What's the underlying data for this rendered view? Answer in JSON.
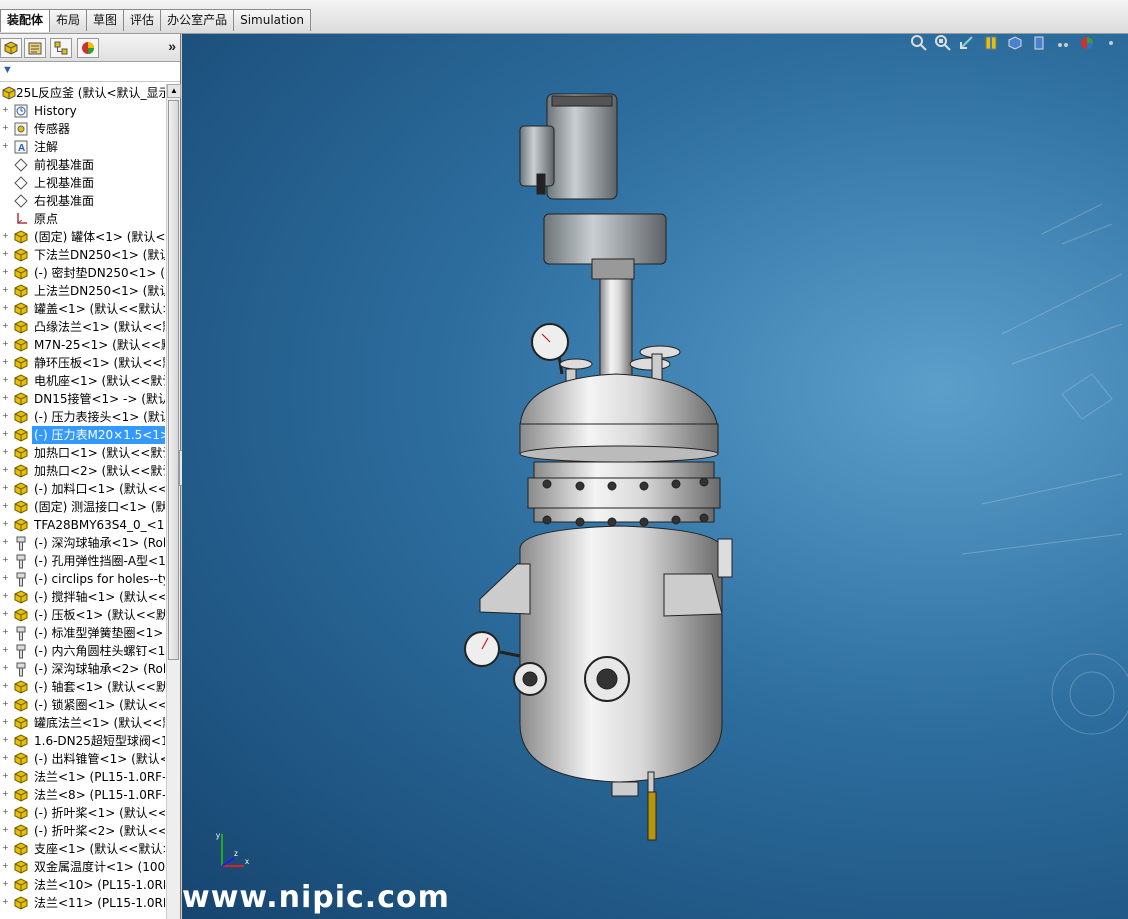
{
  "tabs": [
    {
      "label": "装配体",
      "active": true
    },
    {
      "label": "布局",
      "active": false
    },
    {
      "label": "草图",
      "active": false
    },
    {
      "label": "评估",
      "active": false
    },
    {
      "label": "办公室产品",
      "active": false
    },
    {
      "label": "Simulation",
      "active": false
    }
  ],
  "panel": {
    "expand_label": "»",
    "filter_label": "▼"
  },
  "tree": {
    "root": "25L反应釜 (默认<默认_显示",
    "items": [
      {
        "label": "History",
        "icon": "history-icon"
      },
      {
        "label": "传感器",
        "icon": "sensor-icon"
      },
      {
        "label": "注解",
        "icon": "annotation-icon"
      },
      {
        "label": "前视基准面",
        "icon": "plane-icon"
      },
      {
        "label": "上视基准面",
        "icon": "plane-icon"
      },
      {
        "label": "右视基准面",
        "icon": "plane-icon"
      },
      {
        "label": "原点",
        "icon": "origin-icon"
      },
      {
        "label": "(固定) 罐体<1> (默认<<",
        "icon": "part-icon"
      },
      {
        "label": "下法兰DN250<1> (默认",
        "icon": "part-icon"
      },
      {
        "label": "(-) 密封垫DN250<1> (默",
        "icon": "part-icon"
      },
      {
        "label": "上法兰DN250<1> (默认",
        "icon": "part-icon"
      },
      {
        "label": "罐盖<1> (默认<<默认>",
        "icon": "part-icon"
      },
      {
        "label": "凸缘法兰<1> (默认<<默",
        "icon": "part-icon"
      },
      {
        "label": "M7N-25<1> (默认<<默",
        "icon": "part-icon"
      },
      {
        "label": "静环压板<1> (默认<<默",
        "icon": "part-icon"
      },
      {
        "label": "电机座<1> (默认<<默认",
        "icon": "part-icon"
      },
      {
        "label": "DN15接管<1> -> (默认",
        "icon": "part-icon"
      },
      {
        "label": "(-) 压力表接头<1> (默认",
        "icon": "part-icon"
      },
      {
        "label": "(-) 压力表M20×1.5<1>",
        "icon": "part-icon",
        "selected": true
      },
      {
        "label": "加热口<1> (默认<<默认",
        "icon": "part-icon"
      },
      {
        "label": "加热口<2> (默认<<默认",
        "icon": "part-icon"
      },
      {
        "label": "(-) 加料口<1> (默认<<默",
        "icon": "part-icon"
      },
      {
        "label": "(固定) 测温接口<1> (默认",
        "icon": "part-icon"
      },
      {
        "label": "TFA28BMY63S4_0_<1>",
        "icon": "part-icon"
      },
      {
        "label": "(-) 深沟球轴承<1> (Roll",
        "icon": "toolbox-icon"
      },
      {
        "label": "(-) 孔用弹性挡圈-A型<1",
        "icon": "toolbox-icon"
      },
      {
        "label": "(-) circlips for holes--ty",
        "icon": "toolbox-icon"
      },
      {
        "label": "(-) 搅拌轴<1> (默认<<默",
        "icon": "part-icon"
      },
      {
        "label": "(-) 压板<1> (默认<<默认",
        "icon": "part-icon"
      },
      {
        "label": "(-) 标准型弹簧垫圈<1>",
        "icon": "toolbox-icon"
      },
      {
        "label": "(-) 内六角圆柱头螺钉<1",
        "icon": "toolbox-icon"
      },
      {
        "label": "(-) 深沟球轴承<2> (Roll",
        "icon": "toolbox-icon"
      },
      {
        "label": "(-) 轴套<1> (默认<<默认",
        "icon": "part-icon"
      },
      {
        "label": "(-) 锁紧圈<1> (默认<<默",
        "icon": "part-icon"
      },
      {
        "label": "罐底法兰<1> (默认<<默",
        "icon": "part-icon"
      },
      {
        "label": "1.6-DN25超短型球阀<1",
        "icon": "part-icon"
      },
      {
        "label": "(-) 出料锥管<1> (默认<",
        "icon": "part-icon"
      },
      {
        "label": "法兰<1> (PL15-1.0RF-",
        "icon": "part-icon"
      },
      {
        "label": "法兰<8> (PL15-1.0RF-",
        "icon": "part-icon"
      },
      {
        "label": "(-) 折叶桨<1> (默认<<默",
        "icon": "part-icon"
      },
      {
        "label": "(-) 折叶桨<2> (默认<<默",
        "icon": "part-icon"
      },
      {
        "label": "支座<1> (默认<<默认>",
        "icon": "part-icon"
      },
      {
        "label": "双金属温度计<1> (100<",
        "icon": "part-icon"
      },
      {
        "label": "法兰<10> (PL15-1.0RF-",
        "icon": "part-icon"
      },
      {
        "label": "法兰<11> (PL15-1.0RF-",
        "icon": "part-icon"
      }
    ]
  },
  "viewport": {
    "watermark": "www.nipic.com",
    "triad_labels": [
      "y",
      "x",
      "z"
    ]
  }
}
